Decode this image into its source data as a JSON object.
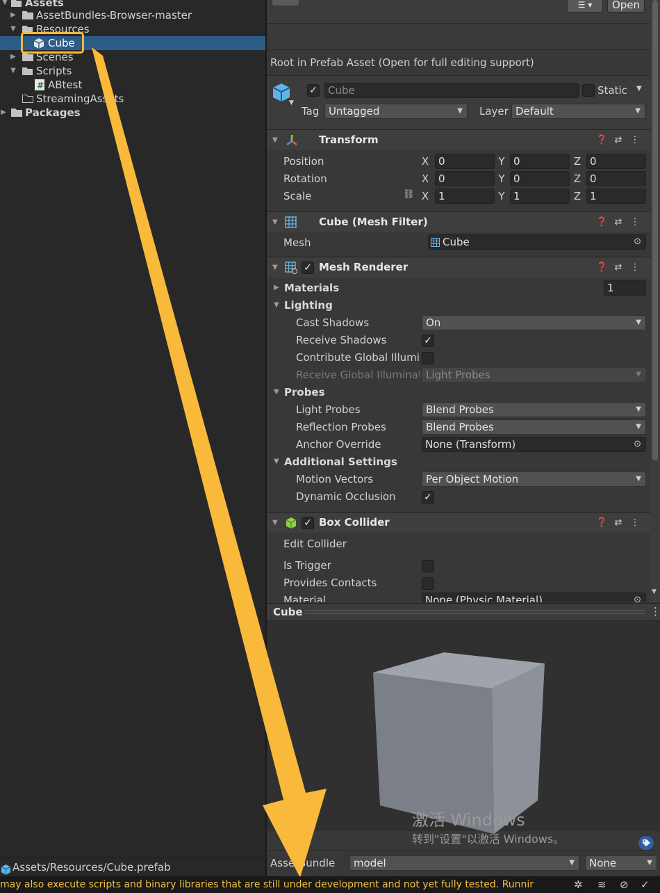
{
  "project": {
    "items": [
      {
        "label": "Assets",
        "kind": "folder-open",
        "bold": true
      },
      {
        "label": "AssetBundles-Browser-master",
        "kind": "folder"
      },
      {
        "label": "Resources",
        "kind": "folder-open"
      },
      {
        "label": "Cube",
        "kind": "prefab",
        "selected": true
      },
      {
        "label": "Scenes",
        "kind": "folder"
      },
      {
        "label": "Scripts",
        "kind": "folder-open"
      },
      {
        "label": "ABtest",
        "kind": "script"
      },
      {
        "label": "StreamingAssets",
        "kind": "folder-empty"
      },
      {
        "label": "Packages",
        "kind": "folder",
        "bold": true
      }
    ],
    "footer_path": "Assets/Resources/Cube.prefab"
  },
  "inspector": {
    "open_label": "Open",
    "prefab_note": "Root in Prefab Asset (Open for full editing support)",
    "object_name": "Cube",
    "static_label": "Static",
    "tag_label": "Tag",
    "tag_value": "Untagged",
    "layer_label": "Layer",
    "layer_value": "Default",
    "transform": {
      "title": "Transform",
      "rows": [
        {
          "label": "Position",
          "x": "0",
          "y": "0",
          "z": "0"
        },
        {
          "label": "Rotation",
          "x": "0",
          "y": "0",
          "z": "0"
        },
        {
          "label": "Scale",
          "x": "1",
          "y": "1",
          "z": "1"
        }
      ],
      "x": "X",
      "y": "Y",
      "z": "Z"
    },
    "mesh_filter": {
      "title": "Cube (Mesh Filter)",
      "mesh_label": "Mesh",
      "mesh_value": "Cube"
    },
    "mesh_renderer": {
      "title": "Mesh Renderer",
      "materials_label": "Materials",
      "materials_count": "1",
      "lighting": "Lighting",
      "cast_shadows": "Cast Shadows",
      "cast_shadows_value": "On",
      "receive_shadows": "Receive Shadows",
      "contribute_gi": "Contribute Global Illumina",
      "receive_gi": "Receive Global Illuminati",
      "receive_gi_value": "Light Probes",
      "probes": "Probes",
      "light_probes": "Light Probes",
      "light_probes_value": "Blend Probes",
      "reflection_probes": "Reflection Probes",
      "reflection_probes_value": "Blend Probes",
      "anchor_override": "Anchor Override",
      "anchor_override_value": "None (Transform)",
      "additional": "Additional Settings",
      "motion_vectors": "Motion Vectors",
      "motion_vectors_value": "Per Object Motion",
      "dynamic_occlusion": "Dynamic Occlusion"
    },
    "box_collider": {
      "title": "Box Collider",
      "edit_collider": "Edit Collider",
      "is_trigger": "Is Trigger",
      "provides_contacts": "Provides Contacts",
      "material": "Material",
      "material_value": "None (Physic Material)"
    },
    "preview_title": "Cube",
    "watermark_1": "激活 Windows",
    "watermark_2": "转到\"设置\"以激活 Windows。",
    "assetbundle_label": "AssetBundle",
    "assetbundle_value": "model",
    "variant_value": "None"
  },
  "status_text": "may also execute scripts and binary libraries that are still under development and not yet fully tested. Runnir",
  "colors": {
    "accent_annotation": "#f9b93a",
    "selection": "#2c5d87"
  }
}
